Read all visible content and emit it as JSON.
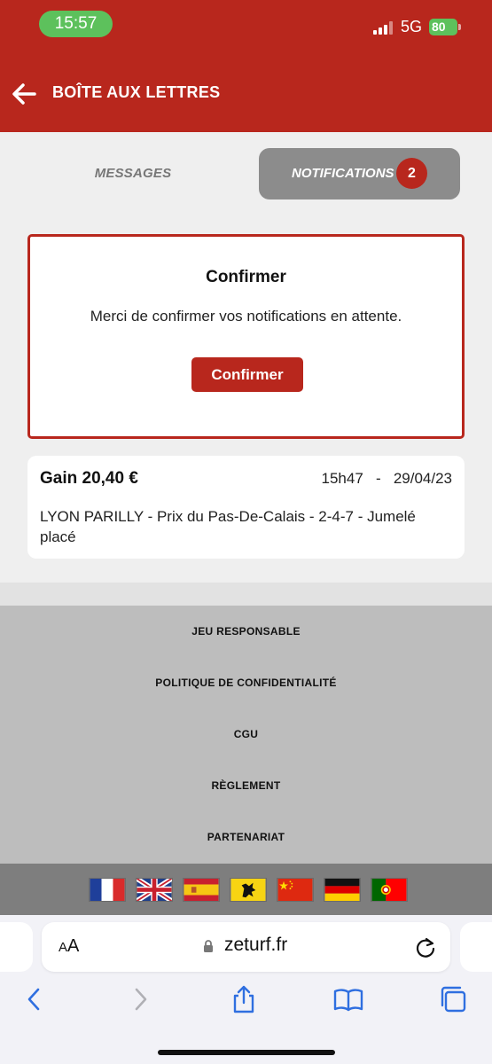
{
  "status_bar": {
    "time": "15:57",
    "network": "5G",
    "battery": "80"
  },
  "header": {
    "title": "BOÎTE AUX LETTRES",
    "back_icon": "arrow-left-icon"
  },
  "tabs": {
    "messages_label": "MESSAGES",
    "notifications_label": "NOTIFICATIONS",
    "notifications_count": "2",
    "active": "notifications"
  },
  "confirm_card": {
    "title": "Confirmer",
    "message": "Merci de confirmer vos notifications en attente.",
    "button_label": "Confirmer"
  },
  "notification": {
    "gain": "Gain 20,40 €",
    "time": "15h47",
    "separator": "-",
    "date": "29/04/23",
    "description": "LYON PARILLY - Prix du Pas-De-Calais - 2-4-7 - Jumelé placé"
  },
  "footer": {
    "links": [
      "JEU RESPONSABLE",
      "POLITIQUE DE CONFIDENTIALITÉ",
      "CGU",
      "RÈGLEMENT",
      "PARTENARIAT"
    ]
  },
  "languages": [
    "french-flag-icon",
    "uk-flag-icon",
    "spanish-flag-icon",
    "flemish-flag-icon",
    "chinese-flag-icon",
    "german-flag-icon",
    "portuguese-flag-icon"
  ],
  "browser": {
    "text_size_label": "AA",
    "url": "zeturf.fr"
  },
  "colors": {
    "brand_red": "#b8271d",
    "status_green": "#5dc15c",
    "tab_active_gray": "#8c8c8c",
    "ios_blue": "#2f6fe0"
  }
}
